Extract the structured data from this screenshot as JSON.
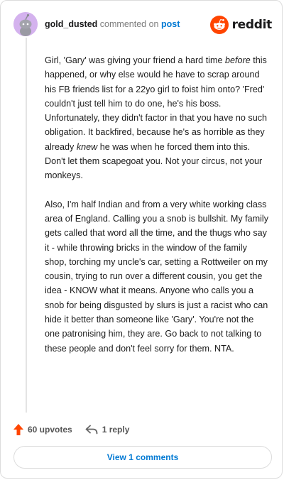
{
  "comment": {
    "username": "gold_dusted",
    "action_text": "commented on",
    "post_link": "post",
    "paragraphs": [
      "Girl, 'Gary' was giving your friend a hard time before this happened, or why else would he have to scrap around his FB friends list for a 22yo girl to foist him onto? 'Fred' couldn't just tell him to do one, he's his boss. Unfortunately, they didn't factor in that you have no such obligation. It backfired, because he's as horrible as they already knew he was when he forced them into this. Don't let them scapegoat you. Not your circus, not your monkeys.",
      "Also, I'm half Indian and from a very white working class area of England. Calling you a snob is bullshit. My family gets called that word all the time, and the thugs who say it - while throwing bricks in the window of the family shop, torching my uncle's car, setting a Rottweiler on my cousin, trying to run over a different cousin, you get the idea - KNOW what it means. Anyone who calls you a snob for being disgusted by slurs is just a racist who can hide it better than someone like 'Gary'. You're not the one patronising him, they are. Go back to not talking to these people and don't feel sorry for them. NTA."
    ],
    "p1_parts": {
      "a": "Girl, 'Gary' was giving your friend a hard time ",
      "b": "before",
      "c": " this happened, or why else would he have to scrap around his FB friends list for a 22yo girl to foist him onto? 'Fred' couldn't just tell him to do one, he's his boss. Unfortunately, they didn't factor in that you have no such obligation. It backfired, because he's as horrible as they already ",
      "d": "knew",
      "e": " he was when he forced them into this. Don't let them scapegoat you. Not your circus, not your monkeys."
    },
    "upvotes_label": "60 upvotes",
    "reply_label": "1 reply",
    "view_comments_label": "View 1 comments"
  },
  "brand": {
    "wordmark": "reddit",
    "accent_color": "#ff4500",
    "link_color": "#0079d3"
  },
  "icons": {
    "logo": "reddit-snoo-icon",
    "upvote": "upvote-arrow-icon",
    "reply": "reply-arrow-icon",
    "avatar": "snoo-avatar-icon"
  }
}
